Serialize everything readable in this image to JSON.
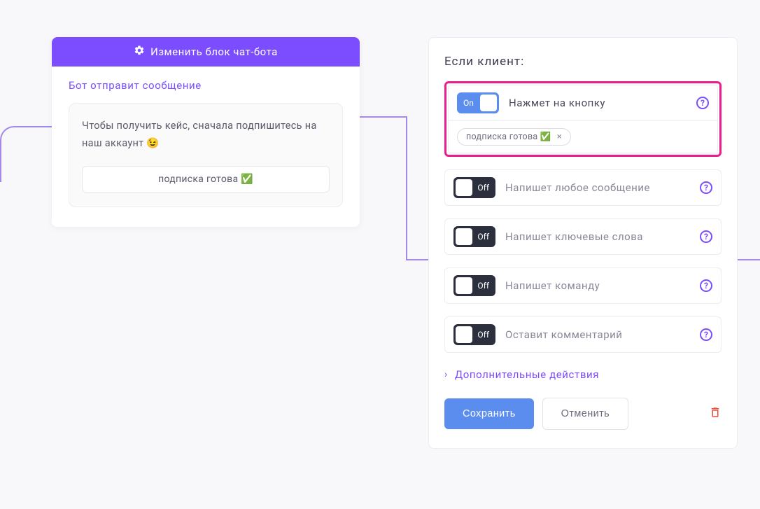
{
  "bot_block": {
    "header": "Изменить блок чат-бота",
    "section_label": "Бот отправит сообщение",
    "message_text": "Чтобы получить кейс, сначала подпишитесь на наш аккаунт 😉",
    "button_label": "подписка готова ✅"
  },
  "right_panel": {
    "title": "Если клиент:",
    "conditions": [
      {
        "toggle_state": "On",
        "text": "Нажмет на кнопку",
        "chip": "подписка готова ✅",
        "chip_remove": "×"
      },
      {
        "toggle_state": "Off",
        "text": "Напишет любое сообщение"
      },
      {
        "toggle_state": "Off",
        "text": "Напишет ключевые слова"
      },
      {
        "toggle_state": "Off",
        "text": "Напишет команду"
      },
      {
        "toggle_state": "Off",
        "text": "Оставит комментарий"
      }
    ],
    "additional_actions": "Дополнительные действия",
    "save_button": "Сохранить",
    "cancel_button": "Отменить"
  }
}
